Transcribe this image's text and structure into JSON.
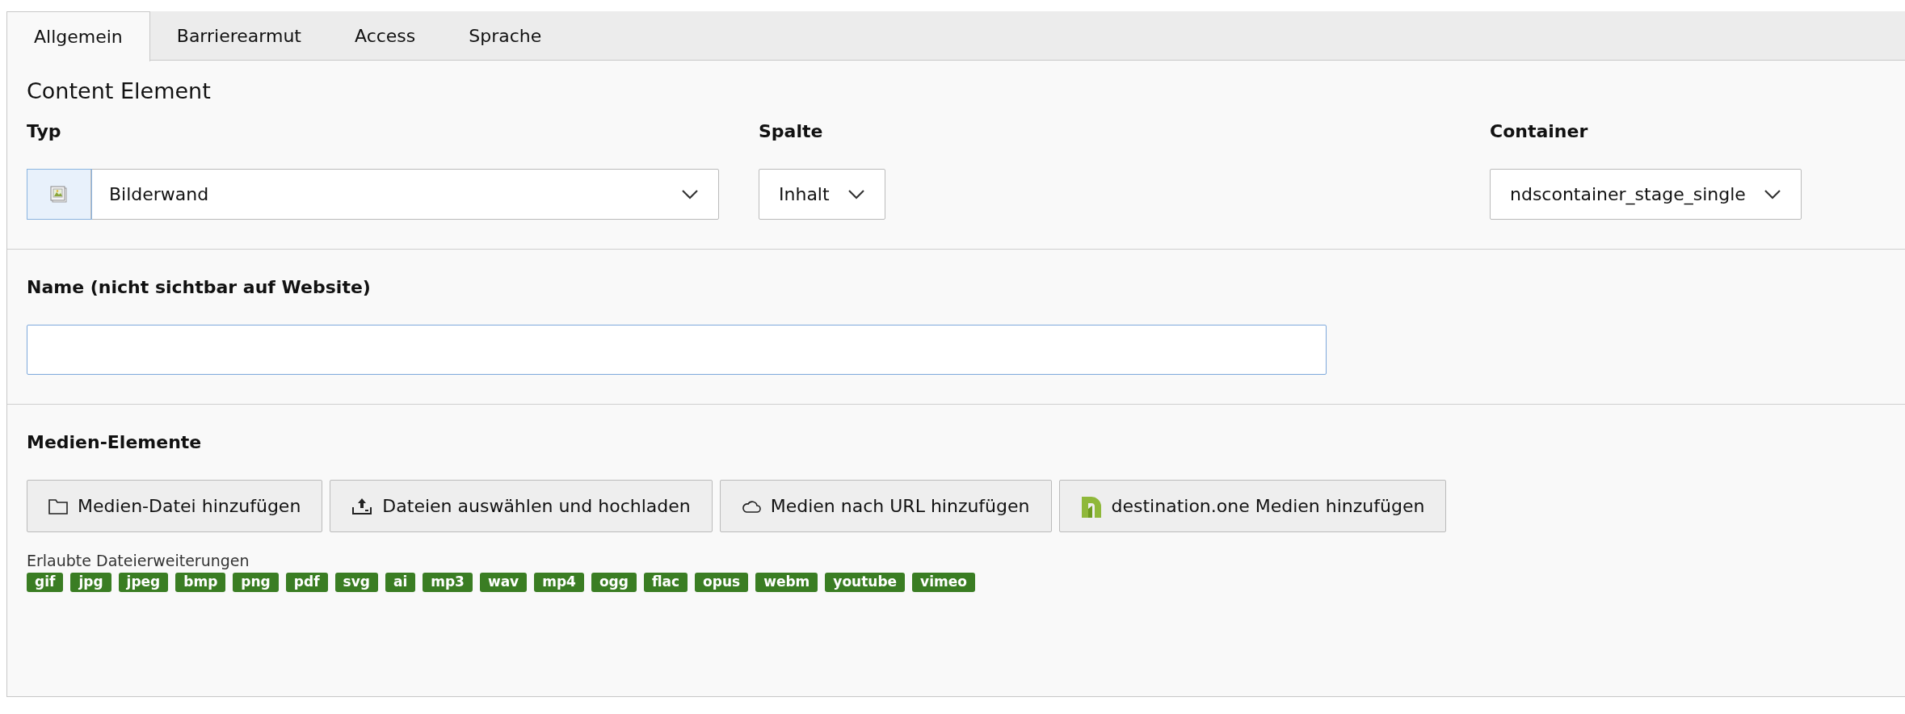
{
  "tabs": [
    {
      "label": "Allgemein",
      "selected": true
    },
    {
      "label": "Barrierearmut",
      "selected": false
    },
    {
      "label": "Access",
      "selected": false
    },
    {
      "label": "Sprache",
      "selected": false
    }
  ],
  "section_title": "Content Element",
  "fields": [
    {
      "label": "Typ",
      "value": "Bilderwand",
      "kind": "icon-select"
    },
    {
      "label": "Spalte",
      "value": "Inhalt",
      "kind": "select"
    },
    {
      "label": "Container",
      "value": "ndscontainer_stage_single",
      "kind": "select"
    }
  ],
  "name_field": {
    "label": "Name (nicht sichtbar auf Website)"
  },
  "media": {
    "label": "Medien-Elemente",
    "buttons": [
      {
        "label": "Medien-Datei hinzufügen",
        "kind": "folder"
      },
      {
        "label": "Dateien auswählen und hochladen",
        "kind": "upload"
      },
      {
        "label": "Medien nach URL hinzufügen",
        "kind": "cloud"
      },
      {
        "label": "destination.one Medien hinzufügen",
        "kind": "logo"
      }
    ],
    "extensions_label": "Erlaubte Dateierweiterungen",
    "extensions": [
      "gif",
      "jpg",
      "jpeg",
      "bmp",
      "png",
      "pdf",
      "svg",
      "ai",
      "mp3",
      "wav",
      "mp4",
      "ogg",
      "flac",
      "opus",
      "webm",
      "youtube",
      "vimeo"
    ]
  }
}
